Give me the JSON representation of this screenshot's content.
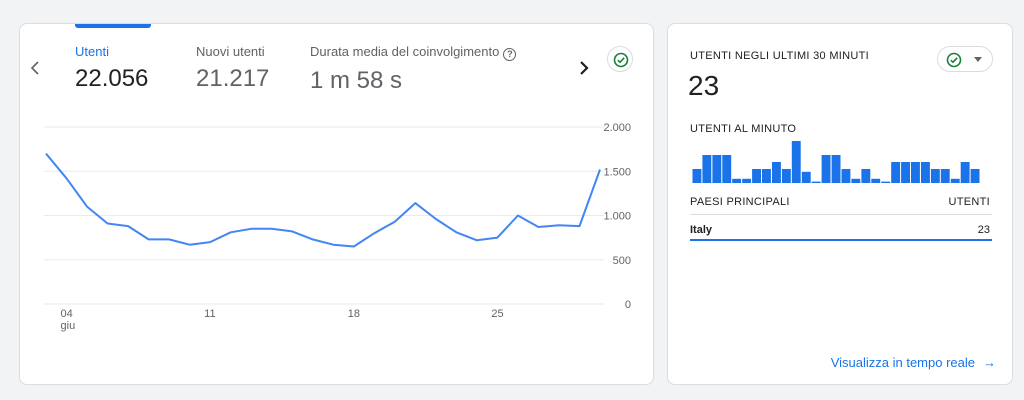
{
  "overview": {
    "metrics": [
      {
        "label": "Utenti",
        "value": "22.056"
      },
      {
        "label": "Nuovi utenti",
        "value": "21.217"
      },
      {
        "label": "Durata media del coinvolgimento",
        "value": "1 m 58 s"
      }
    ],
    "prev_icon": "chevron-left-icon",
    "next_icon": "chevron-right-icon",
    "help_glyph": "?"
  },
  "chart_data": {
    "type": "line",
    "title": "",
    "xlabel": "",
    "ylabel": "",
    "ylim": [
      0,
      2000
    ],
    "y_ticks": [
      "2.000",
      "1.500",
      "1.000",
      "500",
      "0"
    ],
    "x_ticks": [
      {
        "day": 4,
        "label": "04",
        "sublabel": "giu"
      },
      {
        "day": 11,
        "label": "11",
        "sublabel": ""
      },
      {
        "day": 18,
        "label": "18",
        "sublabel": ""
      },
      {
        "day": 25,
        "label": "25",
        "sublabel": ""
      }
    ],
    "grid": true,
    "legend": "none",
    "series": [
      {
        "color": "#4285f4",
        "x": [
          3,
          4,
          5,
          6,
          7,
          8,
          9,
          10,
          11,
          12,
          13,
          14,
          15,
          16,
          17,
          18,
          19,
          20,
          21,
          22,
          23,
          24,
          25,
          26,
          27,
          28,
          29,
          30
        ],
        "values": [
          1700,
          1420,
          1100,
          910,
          880,
          730,
          730,
          670,
          700,
          810,
          850,
          850,
          820,
          730,
          670,
          650,
          800,
          930,
          1140,
          960,
          810,
          720,
          750,
          1000,
          870,
          890,
          880,
          1520
        ]
      }
    ]
  },
  "realtime": {
    "title": "UTENTI NEGLI ULTIMI 30 MINUTI",
    "count": "23",
    "per_minute_label": "UTENTI AL MINUTO",
    "per_minute": [
      1,
      2,
      2,
      2,
      0.3,
      0.3,
      1,
      1,
      1.5,
      1,
      3,
      0.8,
      0.1,
      2,
      2,
      1,
      0.3,
      1,
      0.3,
      0.1,
      1.5,
      1.5,
      1.5,
      1.5,
      1,
      1,
      0.3,
      1.5,
      1,
      0
    ],
    "bar_color": "#1a73e8",
    "columns": {
      "left": "PAESI PRINCIPALI",
      "right": "UTENTI"
    },
    "rows": [
      {
        "country": "Italy",
        "users": "23"
      }
    ],
    "link": "Visualizza in tempo reale",
    "link_arrow": "→"
  }
}
